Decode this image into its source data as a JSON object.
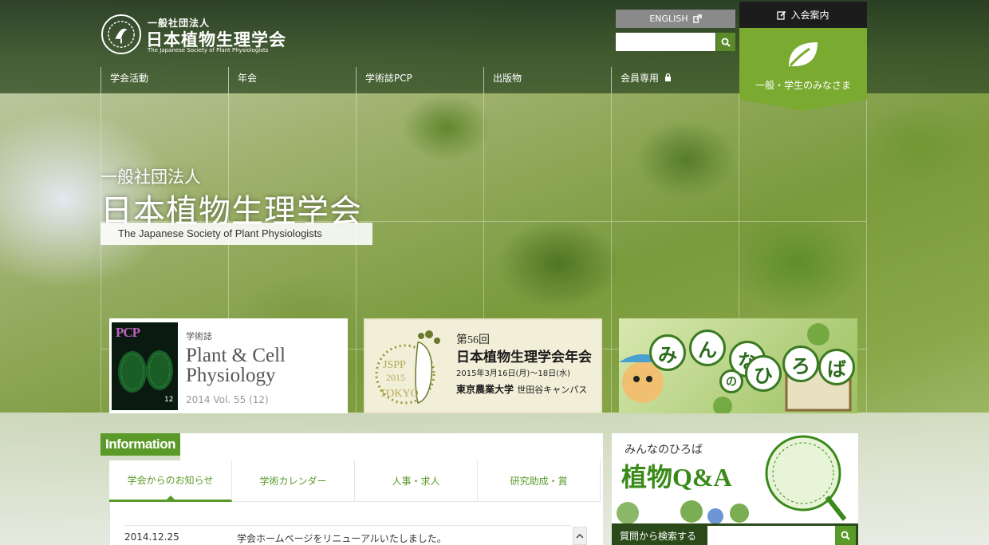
{
  "header": {
    "logo_sub": "一般社団法人",
    "logo_main": "日本植物生理学会",
    "logo_en": "The Japanese Society of Plant Physiologists",
    "english_label": "ENGLISH",
    "search_placeholder": "",
    "join_label": "入会案内",
    "public_label": "一般・学生のみなさま"
  },
  "nav": [
    {
      "label": "学会活動"
    },
    {
      "label": "年会"
    },
    {
      "label": "学術誌PCP"
    },
    {
      "label": "出版物"
    },
    {
      "label": "会員専用"
    }
  ],
  "hero": {
    "sub": "一般社団法人",
    "main": "日本植物生理学会",
    "en": "The Japanese Society of Plant Physiologists"
  },
  "banners": {
    "pcp": {
      "cover_title": "PCP",
      "cover_number": "12",
      "small": "学術誌",
      "title_line1": "Plant & Cell",
      "title_line2": "Physiology",
      "volume": "2014 Vol. 55 (12)"
    },
    "meeting": {
      "emblem_text1": "JSPP",
      "emblem_text2": "2015",
      "emblem_text3": "TOKYO",
      "line1": "第56回",
      "line2": "日本植物生理学会年会",
      "line3": "2015年3月16日(月)〜18日(水)",
      "line4_bold": "東京農業大学",
      "line4_rest": "世田谷キャンパス"
    },
    "hiroba": {
      "chars": [
        "み",
        "ん",
        "な",
        "の",
        "ひ",
        "ろ",
        "ば"
      ]
    }
  },
  "info": {
    "label": "Information",
    "tabs": [
      {
        "label": "学会からのお知らせ"
      },
      {
        "label": "学術カレンダー"
      },
      {
        "label": "人事・求人"
      },
      {
        "label": "研究助成・賞"
      }
    ],
    "news": [
      {
        "date": "2014.12.25",
        "text": "学会ホームページをリニューアルいたしました。"
      }
    ]
  },
  "qa": {
    "line1": "みんなのひろば",
    "line2": "植物Q&A",
    "search_label": "質問から検索する",
    "search_placeholder": ""
  },
  "colors": {
    "accent_green": "#5a9a28",
    "public_green": "#7aaa30",
    "header_dark": "#22361e"
  }
}
